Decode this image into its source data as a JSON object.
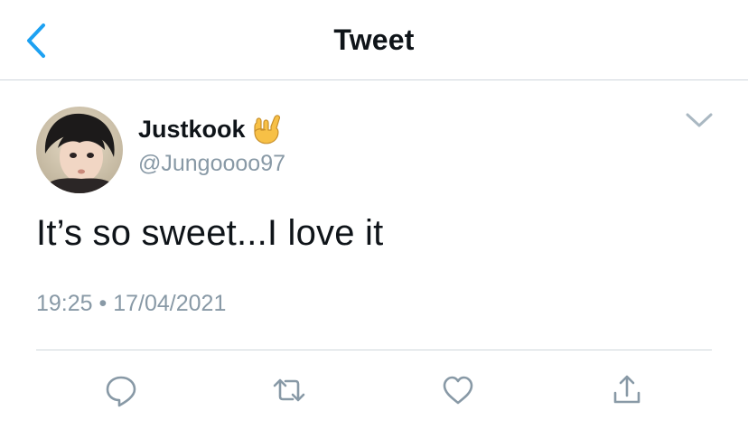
{
  "header": {
    "title": "Tweet",
    "back_icon": "chevron-left-icon"
  },
  "tweet": {
    "display_name": "Justkook",
    "name_emoji": "🤟",
    "handle": "@Jungoooo97",
    "text": "It’s so sweet...I love it",
    "time": "19:25",
    "separator": "•",
    "date": "17/04/2021"
  },
  "actions": [
    {
      "name": "reply",
      "icon": "comment-bubble-icon"
    },
    {
      "name": "retweet",
      "icon": "retweet-arrows-icon"
    },
    {
      "name": "like",
      "icon": "heart-outline-icon"
    },
    {
      "name": "share",
      "icon": "upload-arrow-icon"
    }
  ],
  "colors": {
    "accent": "#1da1f2",
    "muted": "#8899a6",
    "border": "#cfd6dc",
    "text": "#0f1419"
  }
}
